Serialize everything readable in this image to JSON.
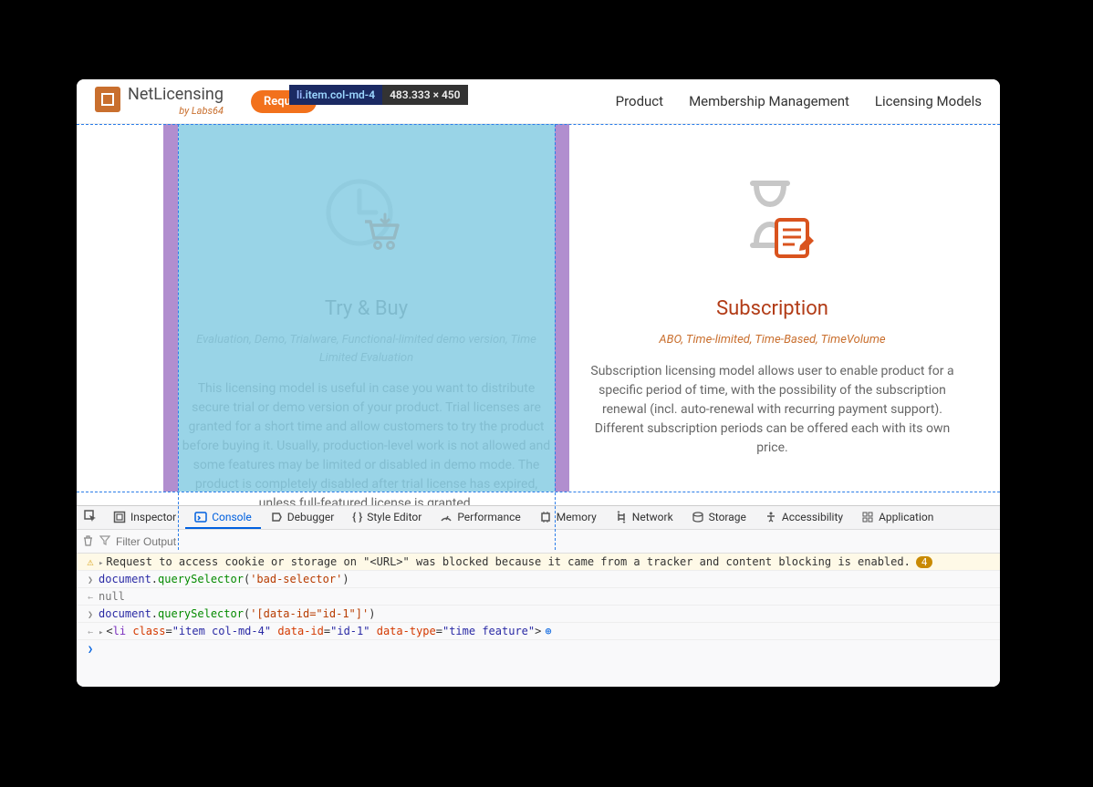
{
  "brand": {
    "name": "NetLicensing",
    "byline": "by Labs64"
  },
  "request_badge": "Reques",
  "inspect_tooltip": {
    "selector": "li.item.col-md-4",
    "dims": "483.333 × 450"
  },
  "nav": {
    "product": "Product",
    "membership": "Membership Management",
    "models": "Licensing Models"
  },
  "cards": {
    "try": {
      "title": "Try & Buy",
      "sub": "Evaluation, Demo, Trialware, Functional-limited demo version, Time Limited Evaluation",
      "desc": "This licensing model is useful in case you want to distribute secure trial or demo version of your product. Trial licenses are granted for a short time and allow customers to try the product before buying it. Usually, production-level work is not allowed and some features may be limited or disabled in demo mode. The product is completely disabled after trial license has expired, unless full-featured license is granted."
    },
    "sub": {
      "title": "Subscription",
      "sub": "ABO, Time-limited, Time-Based, TimeVolume",
      "desc": "Subscription licensing model allows user to enable product for a specific period of time, with the possibility of the subscription renewal (incl. auto-renewal with recurring payment support). Different subscription periods can be offered each with its own price."
    }
  },
  "devtools": {
    "tabs": {
      "inspector": "Inspector",
      "console": "Console",
      "debugger": "Debugger",
      "style": "Style Editor",
      "performance": "Performance",
      "memory": "Memory",
      "network": "Network",
      "storage": "Storage",
      "accessibility": "Accessibility",
      "application": "Application"
    },
    "filter_placeholder": "Filter Output",
    "console": {
      "warn": "Request to access cookie or storage on \"<URL>\" was blocked because it came from a tracker and content blocking is enabled.",
      "warn_count": "4",
      "input1_obj": "document",
      "input1_fn": "querySelector",
      "input1_arg": "'bad-selector'",
      "out1": "null",
      "input2_obj": "document",
      "input2_fn": "querySelector",
      "input2_arg": "'[data-id=\"id-1\"]'",
      "out2_tag": "li",
      "out2_class_attr": "class",
      "out2_class_val": "\"item col-md-4\"",
      "out2_dataid_attr": "data-id",
      "out2_dataid_val": "\"id-1\"",
      "out2_datatype_attr": "data-type",
      "out2_datatype_val": "\"time feature\""
    }
  }
}
